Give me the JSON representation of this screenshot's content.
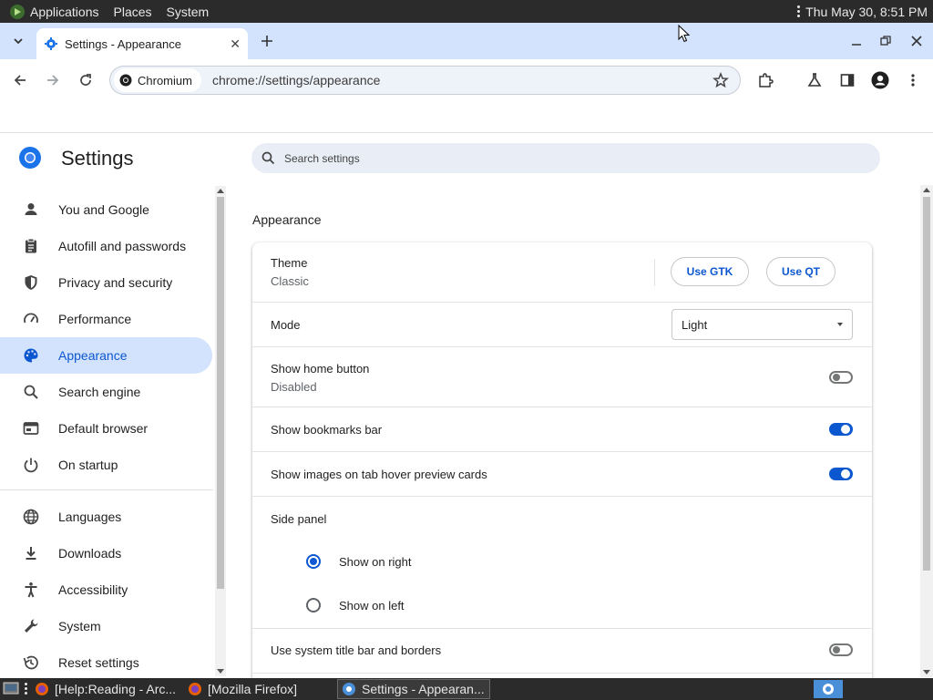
{
  "os_panel": {
    "menus": [
      "Applications",
      "Places",
      "System"
    ],
    "clock": "Thu May 30,  8:51 PM"
  },
  "browser": {
    "tab": {
      "title": "Settings - Appearance"
    },
    "omnibox": {
      "chip": "Chromium",
      "url": "chrome://settings/appearance"
    }
  },
  "settings": {
    "title": "Settings",
    "search_placeholder": "Search settings",
    "nav": [
      {
        "label": "You and Google",
        "icon": "person-icon"
      },
      {
        "label": "Autofill and passwords",
        "icon": "clipboard-icon"
      },
      {
        "label": "Privacy and security",
        "icon": "shield-icon"
      },
      {
        "label": "Performance",
        "icon": "gauge-icon"
      },
      {
        "label": "Appearance",
        "icon": "palette-icon",
        "active": true
      },
      {
        "label": "Search engine",
        "icon": "search-icon"
      },
      {
        "label": "Default browser",
        "icon": "browser-icon"
      },
      {
        "label": "On startup",
        "icon": "power-icon"
      },
      {
        "label": "Languages",
        "icon": "globe-icon"
      },
      {
        "label": "Downloads",
        "icon": "download-icon"
      },
      {
        "label": "Accessibility",
        "icon": "accessibility-icon"
      },
      {
        "label": "System",
        "icon": "wrench-icon"
      },
      {
        "label": "Reset settings",
        "icon": "history-icon"
      }
    ]
  },
  "appearance": {
    "section_title": "Appearance",
    "theme": {
      "label": "Theme",
      "value": "Classic",
      "gtk_button": "Use GTK",
      "qt_button": "Use QT"
    },
    "mode": {
      "label": "Mode",
      "selected": "Light"
    },
    "home_button": {
      "label": "Show home button",
      "sub": "Disabled",
      "enabled": false
    },
    "bookmarks_bar": {
      "label": "Show bookmarks bar",
      "enabled": true
    },
    "tab_hover": {
      "label": "Show images on tab hover preview cards",
      "enabled": true
    },
    "side_panel": {
      "label": "Side panel",
      "right": "Show on right",
      "left": "Show on left",
      "selected": "right"
    },
    "title_bar": {
      "label": "Use system title bar and borders",
      "enabled": false
    }
  },
  "taskbar": {
    "items": [
      "[Help:Reading - Arc...",
      "[Mozilla Firefox]",
      "Settings - Appearan..."
    ]
  },
  "colors": {
    "accent": "#0b57d0",
    "tab_strip": "#d3e3fd",
    "panel": "#2b2b2b"
  }
}
